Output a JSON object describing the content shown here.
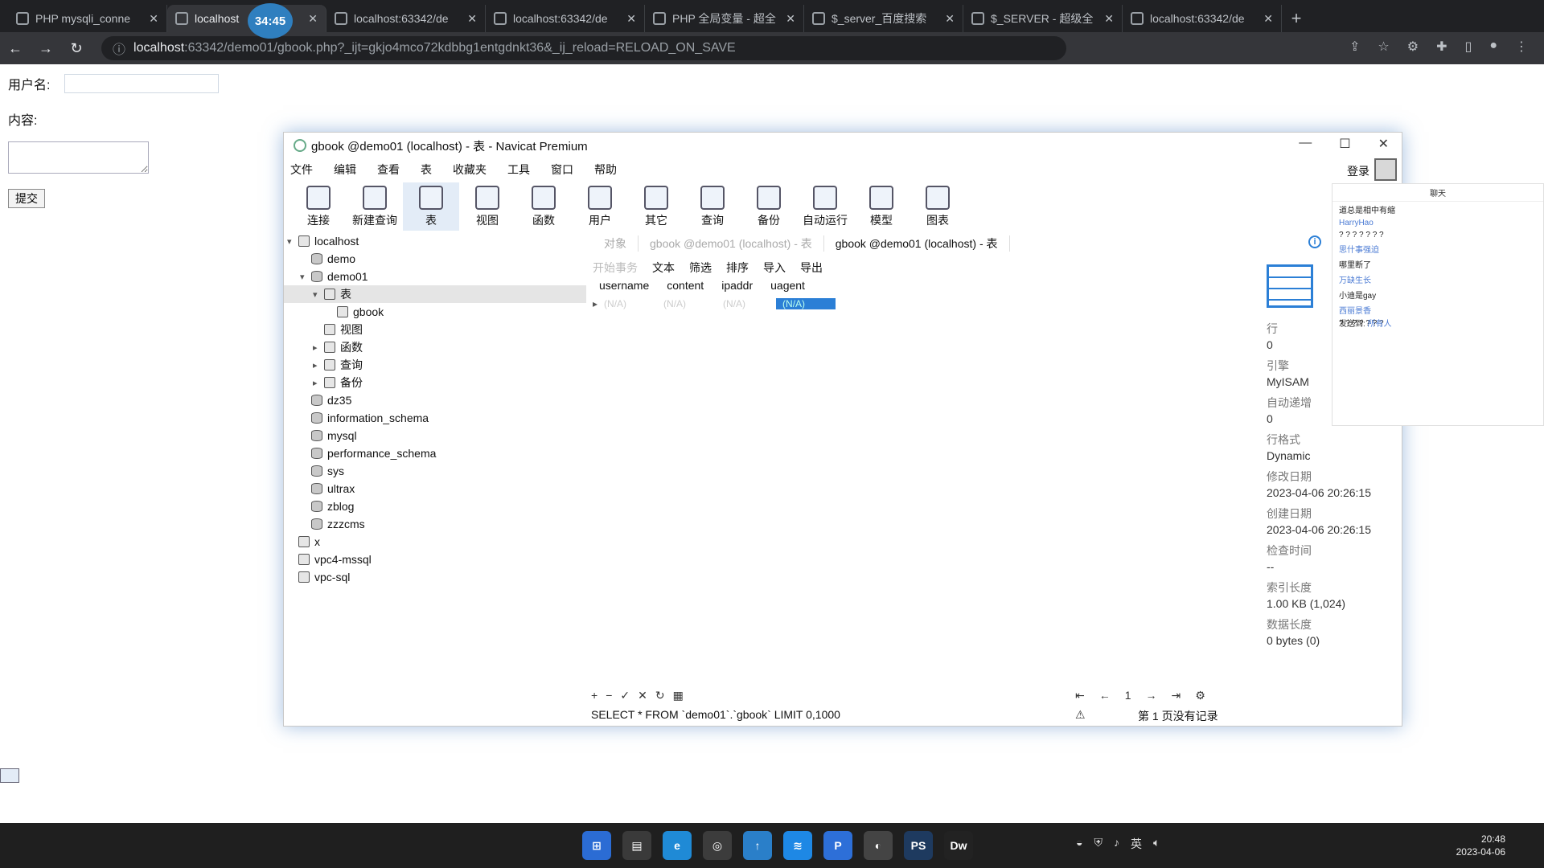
{
  "browser": {
    "tabs": [
      {
        "title": "PHP mysqli_conne"
      },
      {
        "title": "localhost"
      },
      {
        "title": "localhost:63342/de"
      },
      {
        "title": "localhost:63342/de"
      },
      {
        "title": "PHP 全局变量 - 超全"
      },
      {
        "title": "$_server_百度搜索"
      },
      {
        "title": "$_SERVER - 超级全"
      },
      {
        "title": "localhost:63342/de"
      }
    ],
    "new_tab": "+",
    "timer": "34:45",
    "url_host": "localhost",
    "url_rest": ":63342/demo01/gbook.php?_ijt=gkjo4mco72kdbbg1entgdnkt36&_ij_reload=RELOAD_ON_SAVE"
  },
  "page": {
    "username_label": "用户名:",
    "content_label": "内容:",
    "submit_label": "提交"
  },
  "navicat": {
    "title": "gbook @demo01 (localhost) - 表 - Navicat Premium",
    "menu": [
      "文件",
      "编辑",
      "查看",
      "表",
      "收藏夹",
      "工具",
      "窗口",
      "帮助"
    ],
    "login": "登录",
    "toolbar": [
      "连接",
      "新建查询",
      "表",
      "视图",
      "函数",
      "用户",
      "其它",
      "查询",
      "备份",
      "自动运行",
      "模型",
      "图表"
    ],
    "tree": [
      {
        "label": "localhost",
        "level": 0,
        "caret": "v"
      },
      {
        "label": "demo",
        "level": 1,
        "caret": ""
      },
      {
        "label": "demo01",
        "level": 1,
        "caret": "v"
      },
      {
        "label": "表",
        "level": 2,
        "caret": "v"
      },
      {
        "label": "gbook",
        "level": 3,
        "caret": ""
      },
      {
        "label": "视图",
        "level": 2,
        "caret": ""
      },
      {
        "label": "函数",
        "level": 2,
        "caret": ">"
      },
      {
        "label": "查询",
        "level": 2,
        "caret": ">"
      },
      {
        "label": "备份",
        "level": 2,
        "caret": ">"
      },
      {
        "label": "dz35",
        "level": 1,
        "caret": ""
      },
      {
        "label": "information_schema",
        "level": 1,
        "caret": ""
      },
      {
        "label": "mysql",
        "level": 1,
        "caret": ""
      },
      {
        "label": "performance_schema",
        "level": 1,
        "caret": ""
      },
      {
        "label": "sys",
        "level": 1,
        "caret": ""
      },
      {
        "label": "ultrax",
        "level": 1,
        "caret": ""
      },
      {
        "label": "zblog",
        "level": 1,
        "caret": ""
      },
      {
        "label": "zzzcms",
        "level": 1,
        "caret": ""
      },
      {
        "label": "x",
        "level": 0,
        "caret": ""
      },
      {
        "label": "vpc4-mssql",
        "level": 0,
        "caret": ""
      },
      {
        "label": "vpc-sql",
        "level": 0,
        "caret": ""
      }
    ],
    "obj_tabs": [
      "对象",
      "gbook @demo01 (localhost) - 表",
      "gbook @demo01 (localhost) - 表"
    ],
    "obj_actions": [
      "开始事务",
      "文本",
      "筛选",
      "排序",
      "导入",
      "导出"
    ],
    "columns": [
      "username",
      "content",
      "ipaddr",
      "uagent"
    ],
    "row_cells": [
      "(N/A)",
      "(N/A)",
      "(N/A)",
      "(N/A)"
    ],
    "info": [
      {
        "label": "行",
        "value": "0"
      },
      {
        "label": "引擎",
        "value": "MyISAM"
      },
      {
        "label": "自动递增",
        "value": "0"
      },
      {
        "label": "行格式",
        "value": "Dynamic"
      },
      {
        "label": "修改日期",
        "value": "2023-04-06 20:26:15"
      },
      {
        "label": "创建日期",
        "value": "2023-04-06 20:26:15"
      },
      {
        "label": "检查时间",
        "value": "--"
      },
      {
        "label": "索引长度",
        "value": "1.00 KB (1,024)"
      },
      {
        "label": "数据长度",
        "value": "0 bytes (0)"
      }
    ],
    "bottom_icons": [
      "+",
      "−",
      "✓",
      "✕",
      "↻",
      "▦"
    ],
    "sql": "SELECT * FROM `demo01`.`gbook` LIMIT 0,1000",
    "pager": [
      "⇤",
      "←",
      "1",
      "→",
      "⇥",
      "⚙"
    ],
    "status": "第 1 页没有记录"
  },
  "chat": {
    "title": "聊天",
    "messages": [
      "道总是相中有缩",
      "HarryHao",
      "? ? ? ? ? ? ?",
      "思什事强迫",
      "哪里断了",
      "万缺生长",
      "小迪是gay",
      "西丽景香",
      "? ? ? ? ? ? ?"
    ],
    "send_to_label": "发送到:",
    "send_to_value": "所有人"
  },
  "taskbar": {
    "apps": [
      "⊞",
      "▤",
      "e",
      "◎",
      "↑",
      "≋",
      "P",
      "◐",
      "PS",
      "Dw"
    ],
    "lang": "英",
    "time": "20:48",
    "date": "2023-04-06"
  }
}
